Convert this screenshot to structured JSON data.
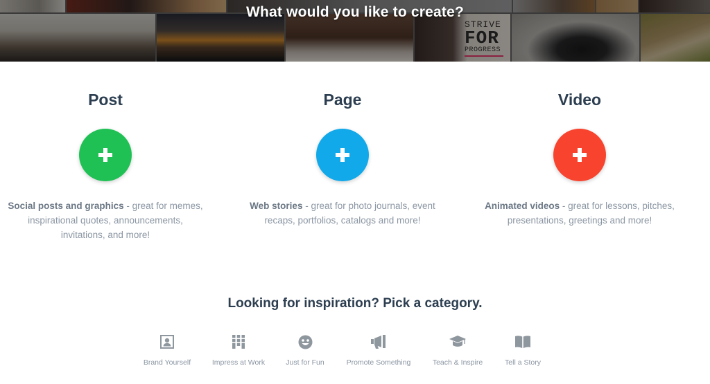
{
  "banner": {
    "title": "What would you like to create?",
    "poster": {
      "line1": "STRIVE",
      "line2": "FOR",
      "line3": "PROGRESS"
    }
  },
  "options": [
    {
      "title": "Post",
      "color": "#1fc155",
      "icon": "plus-icon",
      "bold": "Social posts and graphics",
      "rest": " - great for memes, inspirational quotes, announcements, invitations, and more!"
    },
    {
      "title": "Page",
      "color": "#11a9ea",
      "icon": "plus-icon",
      "bold": "Web stories",
      "rest": " - great for photo journals, event recaps, portfolios, catalogs and more!"
    },
    {
      "title": "Video",
      "color": "#f8432e",
      "icon": "plus-icon",
      "bold": "Animated videos",
      "rest": " - great for lessons, pitches, presentations, greetings and more!"
    }
  ],
  "inspiration": {
    "title": "Looking for inspiration? Pick a category.",
    "icon_color": "#8e969e",
    "categories": [
      {
        "label": "Brand Yourself",
        "icon": "portrait-icon"
      },
      {
        "label": "Impress at Work",
        "icon": "building-icon"
      },
      {
        "label": "Just for Fun",
        "icon": "smiley-icon"
      },
      {
        "label": "Promote Something",
        "icon": "megaphone-icon"
      },
      {
        "label": "Teach & Inspire",
        "icon": "graduation-cap-icon"
      },
      {
        "label": "Tell a Story",
        "icon": "book-icon"
      }
    ]
  }
}
